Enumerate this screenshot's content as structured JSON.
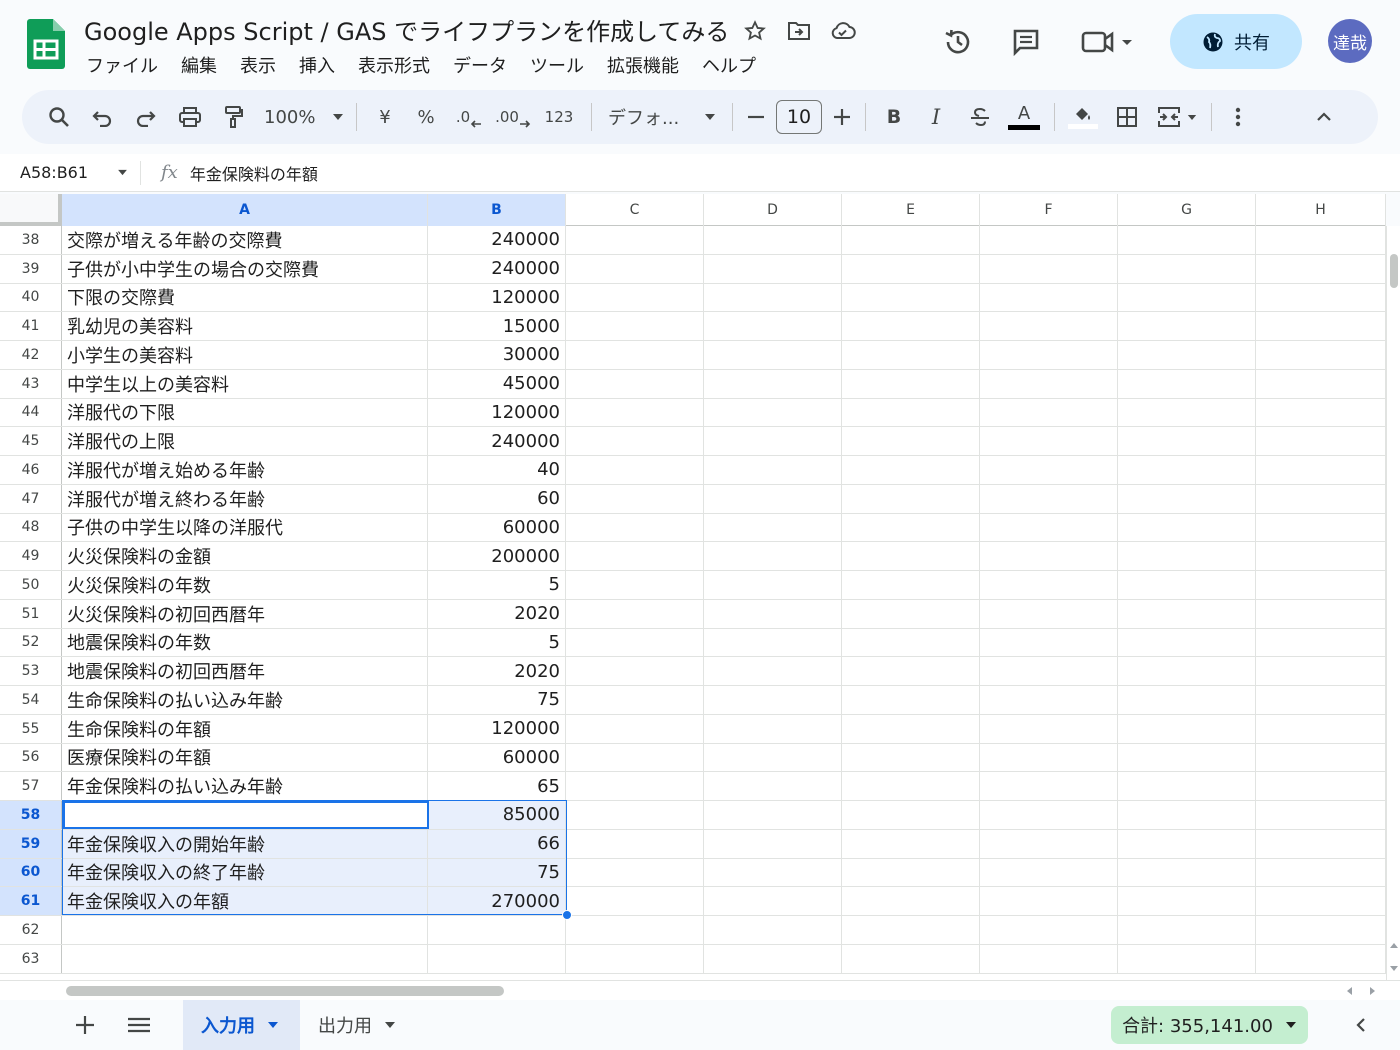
{
  "header": {
    "title": "Google Apps Script / GAS でライフプランを作成してみる",
    "menu": [
      "ファイル",
      "編集",
      "表示",
      "挿入",
      "表示形式",
      "データ",
      "ツール",
      "拡張機能",
      "ヘルプ"
    ],
    "share_label": "共有",
    "avatar_label": "達哉"
  },
  "toolbar": {
    "zoom": "100%",
    "currency": "¥",
    "percent": "%",
    "dec_decrease": ".0",
    "dec_increase": ".00",
    "number_format": "123",
    "font": "デフォ...",
    "font_size": "10",
    "bold": "B",
    "italic": "I",
    "text_color": "A"
  },
  "formula_bar": {
    "name_box": "A58:B61",
    "fx": "fx",
    "content": "年金保険料の年額"
  },
  "grid": {
    "columns": [
      "A",
      "B",
      "C",
      "D",
      "E",
      "F",
      "G",
      "H"
    ],
    "rows": [
      {
        "n": "38",
        "a": "交際が増える年齢の交際費",
        "b": "240000"
      },
      {
        "n": "39",
        "a": "子供が小中学生の場合の交際費",
        "b": "240000"
      },
      {
        "n": "40",
        "a": "下限の交際費",
        "b": "120000"
      },
      {
        "n": "41",
        "a": "乳幼児の美容料",
        "b": "15000"
      },
      {
        "n": "42",
        "a": "小学生の美容料",
        "b": "30000"
      },
      {
        "n": "43",
        "a": "中学生以上の美容料",
        "b": "45000"
      },
      {
        "n": "44",
        "a": "洋服代の下限",
        "b": "120000"
      },
      {
        "n": "45",
        "a": "洋服代の上限",
        "b": "240000"
      },
      {
        "n": "46",
        "a": "洋服代が増え始める年齢",
        "b": "40"
      },
      {
        "n": "47",
        "a": "洋服代が増え終わる年齢",
        "b": "60"
      },
      {
        "n": "48",
        "a": "子供の中学生以降の洋服代",
        "b": "60000"
      },
      {
        "n": "49",
        "a": "火災保険料の金額",
        "b": "200000"
      },
      {
        "n": "50",
        "a": "火災保険料の年数",
        "b": "5"
      },
      {
        "n": "51",
        "a": "火災保険料の初回西暦年",
        "b": "2020"
      },
      {
        "n": "52",
        "a": "地震保険料の年数",
        "b": "5"
      },
      {
        "n": "53",
        "a": "地震保険料の初回西暦年",
        "b": "2020"
      },
      {
        "n": "54",
        "a": "生命保険料の払い込み年齢",
        "b": "75"
      },
      {
        "n": "55",
        "a": "生命保険料の年額",
        "b": "120000"
      },
      {
        "n": "56",
        "a": "医療保険料の年額",
        "b": "60000"
      },
      {
        "n": "57",
        "a": "年金保険料の払い込み年齢",
        "b": "65"
      },
      {
        "n": "58",
        "a": "年金保険料の年額",
        "b": "85000",
        "sel": true
      },
      {
        "n": "59",
        "a": "年金保険収入の開始年齢",
        "b": "66",
        "sel": true
      },
      {
        "n": "60",
        "a": "年金保険収入の終了年齢",
        "b": "75",
        "sel": true
      },
      {
        "n": "61",
        "a": "年金保険収入の年額",
        "b": "270000",
        "sel": true
      },
      {
        "n": "62",
        "a": "",
        "b": ""
      },
      {
        "n": "63",
        "a": "",
        "b": ""
      }
    ]
  },
  "sheets": {
    "tabs": [
      "入力用",
      "出力用"
    ],
    "active": "入力用",
    "sum": "合計: 355,141.00"
  },
  "colors": {
    "accent": "#1a73e8",
    "share_bg": "#c2e7ff",
    "sum_bg": "#c4eed0"
  }
}
